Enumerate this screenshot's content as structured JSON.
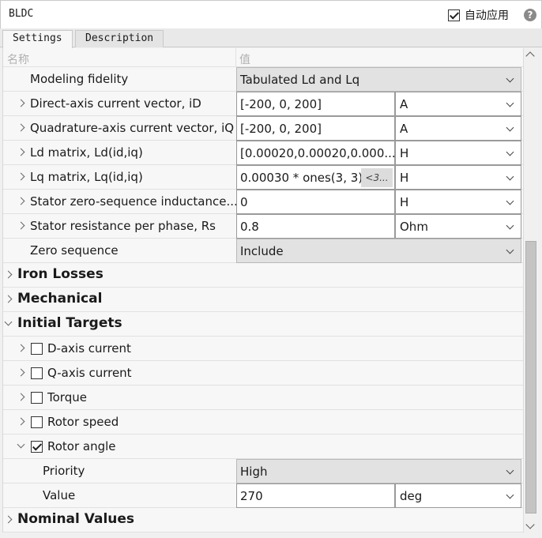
{
  "window": {
    "title": "BLDC",
    "auto_apply_label": "自动应用",
    "auto_apply_checked": true
  },
  "tabs": [
    {
      "label": "Settings"
    },
    {
      "label": "Description"
    }
  ],
  "header": {
    "name": "名称",
    "value": "值"
  },
  "params": {
    "fidelity": {
      "label": "Modeling fidelity",
      "value": "Tabulated Ld and Lq"
    },
    "id": {
      "label": "Direct-axis current vector, iD",
      "value": "[-200, 0, 200]",
      "unit": "A"
    },
    "iq": {
      "label": "Quadrature-axis current vector, iQ",
      "value": "[-200, 0, 200]",
      "unit": "A"
    },
    "ld": {
      "label": "Ld matrix, Ld(id,iq)",
      "value": "[0.00020,0.00020,0.000...",
      "unit": "H"
    },
    "lq": {
      "label": "Lq matrix, Lq(id,iq)",
      "value": "0.00030 * ones(3, 3)",
      "badge": "<3...",
      "unit": "H"
    },
    "l0": {
      "label": "Stator zero-sequence inductance...",
      "value": "0",
      "unit": "H"
    },
    "rs": {
      "label": "Stator resistance per phase, Rs",
      "value": "0.8",
      "unit": "Ohm"
    },
    "zero_seq": {
      "label": "Zero sequence",
      "value": "Include"
    }
  },
  "groups": {
    "iron": {
      "label": "Iron Losses"
    },
    "mech": {
      "label": "Mechanical"
    },
    "init": {
      "label": "Initial Targets"
    },
    "nominal": {
      "label": "Nominal Values"
    }
  },
  "targets": {
    "d_axis": {
      "label": "D-axis current",
      "checked": false
    },
    "q_axis": {
      "label": "Q-axis current",
      "checked": false
    },
    "torque": {
      "label": "Torque",
      "checked": false
    },
    "speed": {
      "label": "Rotor speed",
      "checked": false
    },
    "angle": {
      "label": "Rotor angle",
      "checked": true,
      "priority_label": "Priority",
      "priority_value": "High",
      "value_label": "Value",
      "value": "270",
      "unit": "deg"
    }
  }
}
